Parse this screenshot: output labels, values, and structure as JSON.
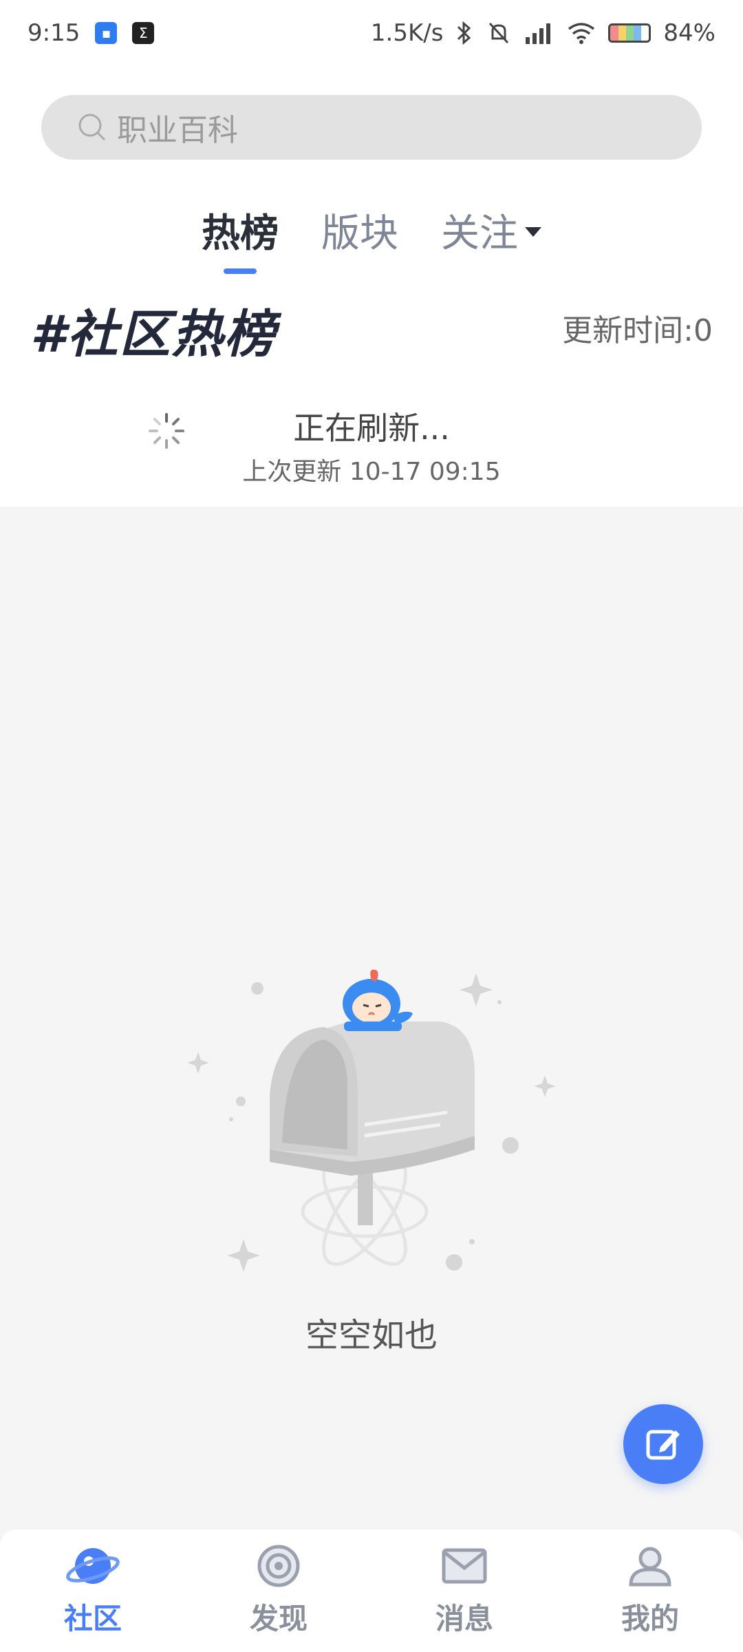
{
  "status_bar": {
    "time": "9:15",
    "net_speed": "1.5K/s",
    "battery": "84%"
  },
  "search": {
    "placeholder": "职业百科"
  },
  "tabs": [
    {
      "label": "热榜",
      "active": true
    },
    {
      "label": "版块",
      "active": false
    },
    {
      "label": "关注",
      "active": false
    }
  ],
  "section": {
    "title": "#社区热榜",
    "update_time": "更新时间:0"
  },
  "refresh": {
    "status": "正在刷新...",
    "last_update": "上次更新 10-17 09:15"
  },
  "empty_state": {
    "text": "空空如也"
  },
  "bottom_nav": [
    {
      "label": "社区",
      "icon": "planet-icon",
      "active": true
    },
    {
      "label": "发现",
      "icon": "target-icon",
      "active": false
    },
    {
      "label": "消息",
      "icon": "mail-icon",
      "active": false
    },
    {
      "label": "我的",
      "icon": "user-icon",
      "active": false
    }
  ],
  "colors": {
    "accent": "#4a7ef6",
    "title": "#23283a"
  }
}
